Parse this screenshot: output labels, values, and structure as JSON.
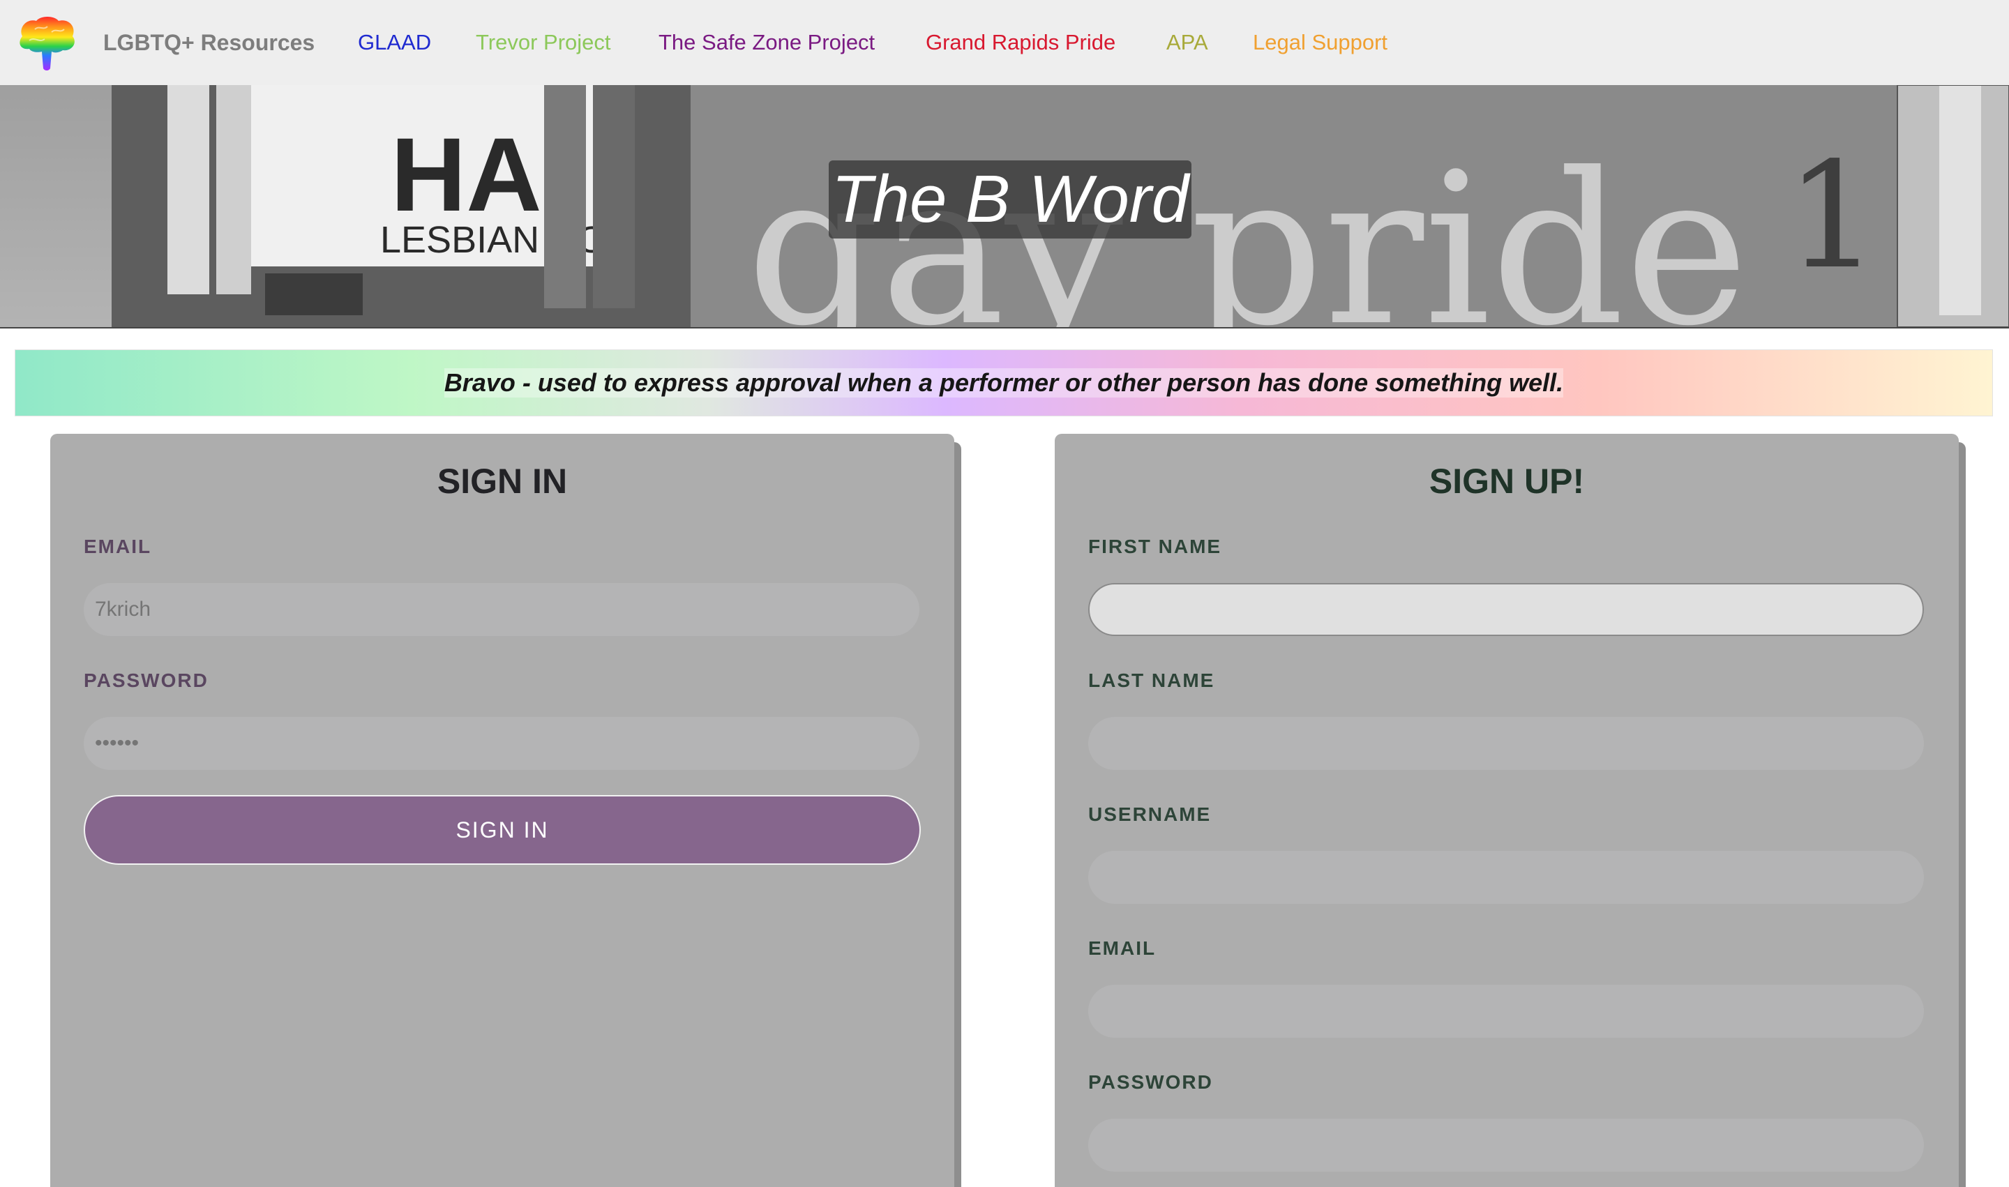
{
  "navbar": {
    "brand": "LGBTQ+ Resources",
    "logo_icon": "rainbow-brain-icon",
    "links": [
      {
        "label": "GLAAD",
        "color": "#1f2ad0"
      },
      {
        "label": "Trevor Project",
        "color": "#8cc85a"
      },
      {
        "label": "The Safe Zone Project",
        "color": "#7a1a82"
      },
      {
        "label": "Grand Rapids Pride",
        "color": "#d8182f"
      },
      {
        "label": "APA",
        "color": "#a8aa3a"
      },
      {
        "label": "Legal Support",
        "color": "#f0a030"
      }
    ]
  },
  "hero": {
    "title": "The B Word",
    "photo_text_1": "HA",
    "photo_text_2": "LESBIAN CO",
    "photo_text_3": "gay pride",
    "photo_text_4": "1"
  },
  "definition": {
    "text": "Bravo - used to express approval when a performer or other person has done something well."
  },
  "signin": {
    "title": "SIGN IN",
    "email_label": "EMAIL",
    "email_placeholder": "7krich",
    "password_label": "PASSWORD",
    "password_placeholder": "••••••",
    "button_label": "SIGN IN"
  },
  "signup": {
    "title": "SIGN UP!",
    "first_name_label": "FIRST NAME",
    "last_name_label": "LAST NAME",
    "username_label": "USERNAME",
    "email_label": "EMAIL",
    "password_label": "PASSWORD"
  },
  "colors": {
    "signin_button": "#86668d",
    "card_background": "#adadad"
  }
}
